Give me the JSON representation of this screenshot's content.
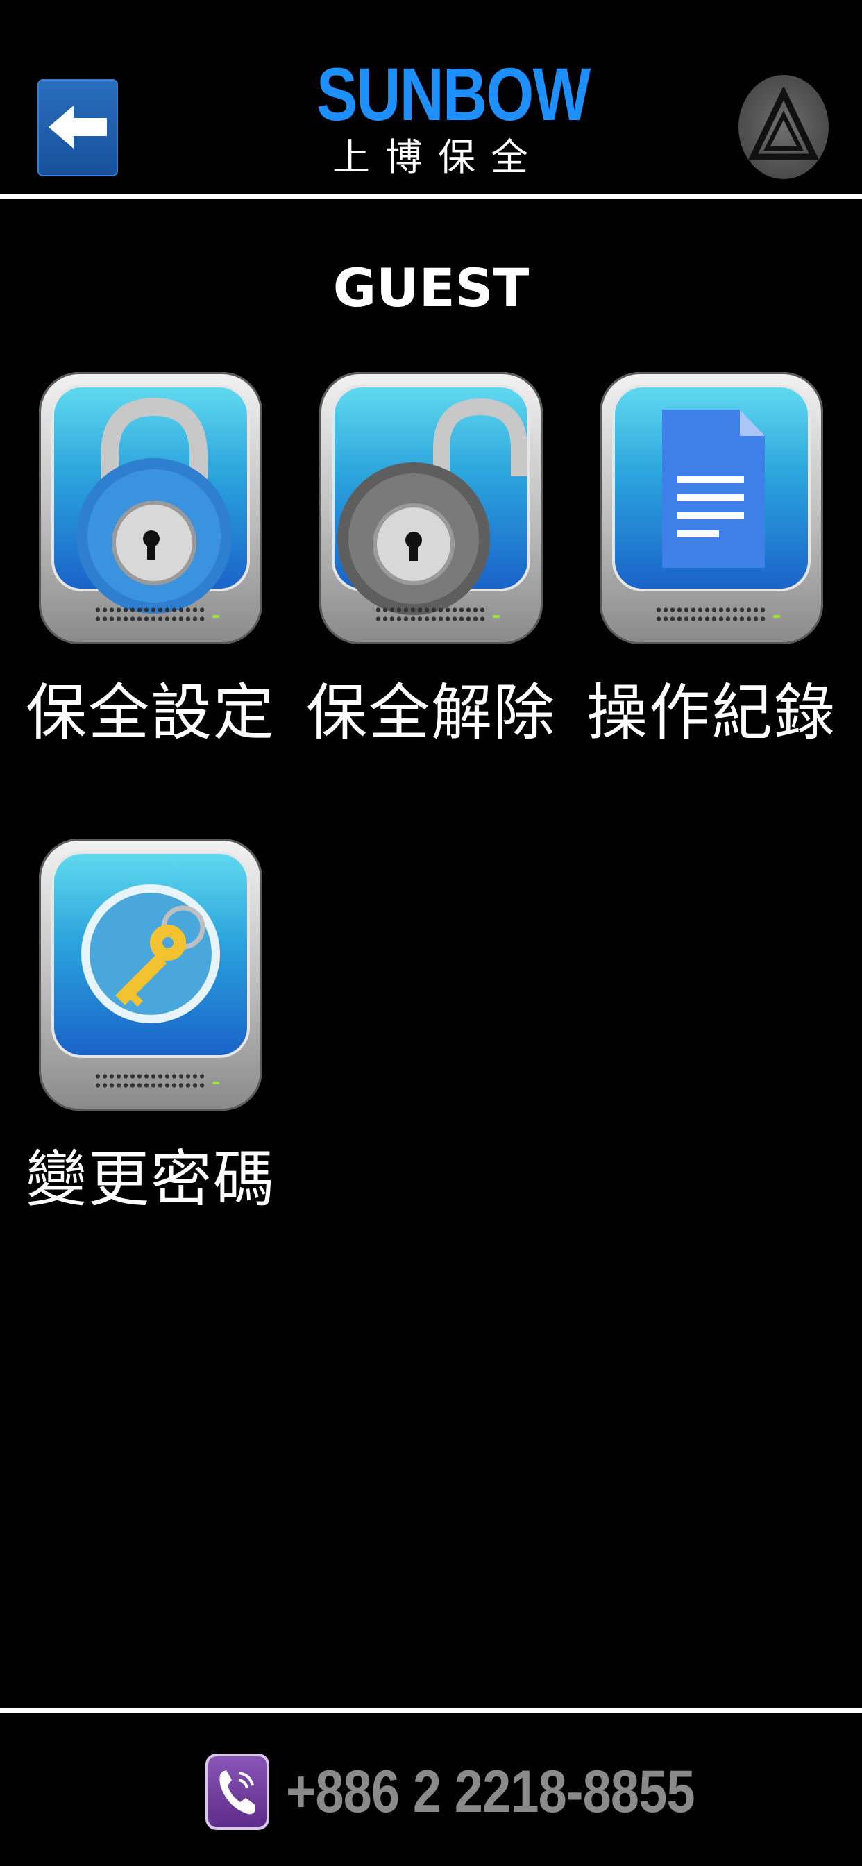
{
  "header": {
    "back_icon": "arrow-left-icon",
    "brand_name": "SUNBOW",
    "brand_subtitle": "上博保全",
    "logo_icon": "triangle-logo-icon",
    "brand_color": "#1e8fff"
  },
  "section_title": "GUEST",
  "tiles": [
    {
      "label": "保全設定",
      "icon": "lock-closed-icon"
    },
    {
      "label": "保全解除",
      "icon": "lock-open-icon"
    },
    {
      "label": "操作紀錄",
      "icon": "document-icon"
    },
    {
      "label": "變更密碼",
      "icon": "key-icon"
    }
  ],
  "footer": {
    "phone_icon": "phone-call-icon",
    "phone_number": "+886 2 2218-8855"
  }
}
